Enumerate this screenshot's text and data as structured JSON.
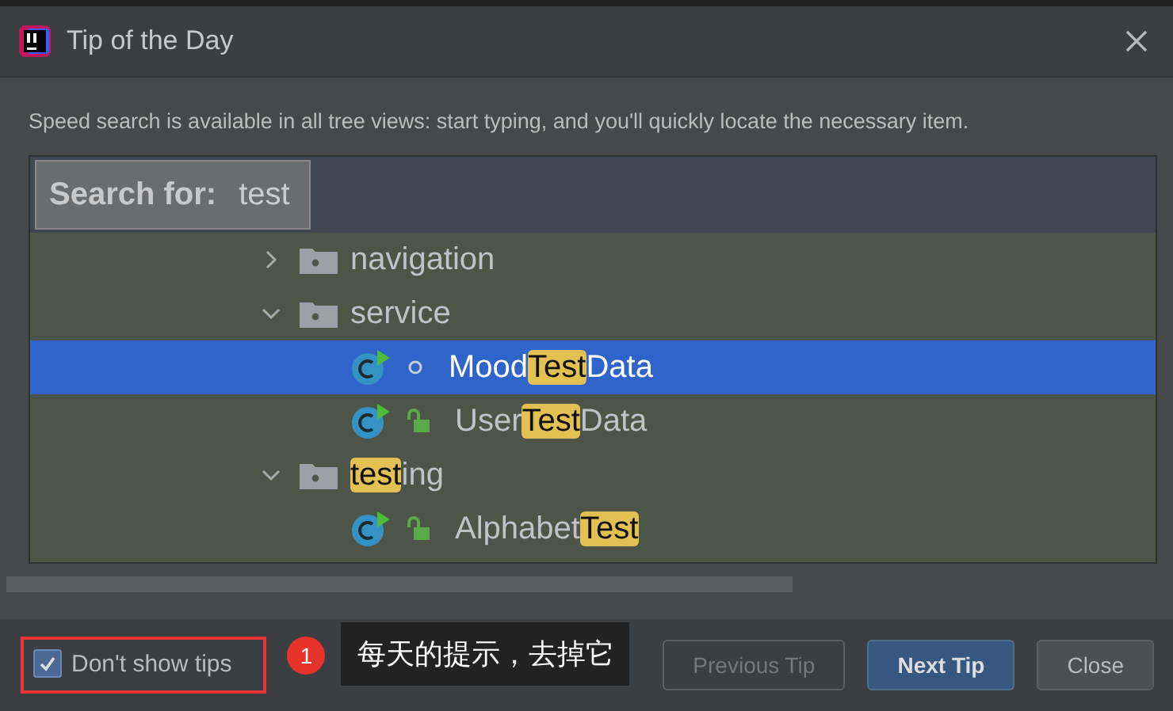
{
  "window": {
    "title": "Tip of the Day"
  },
  "tip": "Speed search is available in all tree views: start typing, and you'll quickly locate the necessary item.",
  "search": {
    "label": "Search for:",
    "value": "test"
  },
  "tree": [
    {
      "kind": "folder",
      "expanded": false,
      "selected": false,
      "parts": [
        {
          "text": "navigation",
          "match": false
        }
      ]
    },
    {
      "kind": "folder",
      "expanded": true,
      "selected": false,
      "parts": [
        {
          "text": "service",
          "match": false
        }
      ],
      "children": [
        {
          "kind": "class",
          "public": false,
          "selected": true,
          "parts": [
            {
              "text": "Mood",
              "match": false
            },
            {
              "text": "Test",
              "match": true
            },
            {
              "text": "Data",
              "match": false
            }
          ]
        },
        {
          "kind": "class",
          "public": true,
          "selected": false,
          "parts": [
            {
              "text": "User",
              "match": false
            },
            {
              "text": "Test",
              "match": true
            },
            {
              "text": "Data",
              "match": false
            }
          ]
        }
      ]
    },
    {
      "kind": "folder",
      "expanded": true,
      "selected": false,
      "parts": [
        {
          "text": "test",
          "match": true
        },
        {
          "text": "ing",
          "match": false
        }
      ],
      "children": [
        {
          "kind": "class",
          "public": true,
          "selected": false,
          "parts": [
            {
              "text": "Alphabet",
              "match": false
            },
            {
              "text": "Test",
              "match": true
            }
          ]
        }
      ]
    }
  ],
  "dont_show": {
    "label": "Don't show tips",
    "checked": true
  },
  "buttons": [
    {
      "label": "Previous Tip",
      "kind": "secondary",
      "disabled": true
    },
    {
      "label": "Next Tip",
      "kind": "primary",
      "disabled": false
    },
    {
      "label": "Close",
      "kind": "secondary",
      "disabled": false
    }
  ],
  "annotation": {
    "number": "1",
    "text": "每天的提示，去掉它"
  }
}
